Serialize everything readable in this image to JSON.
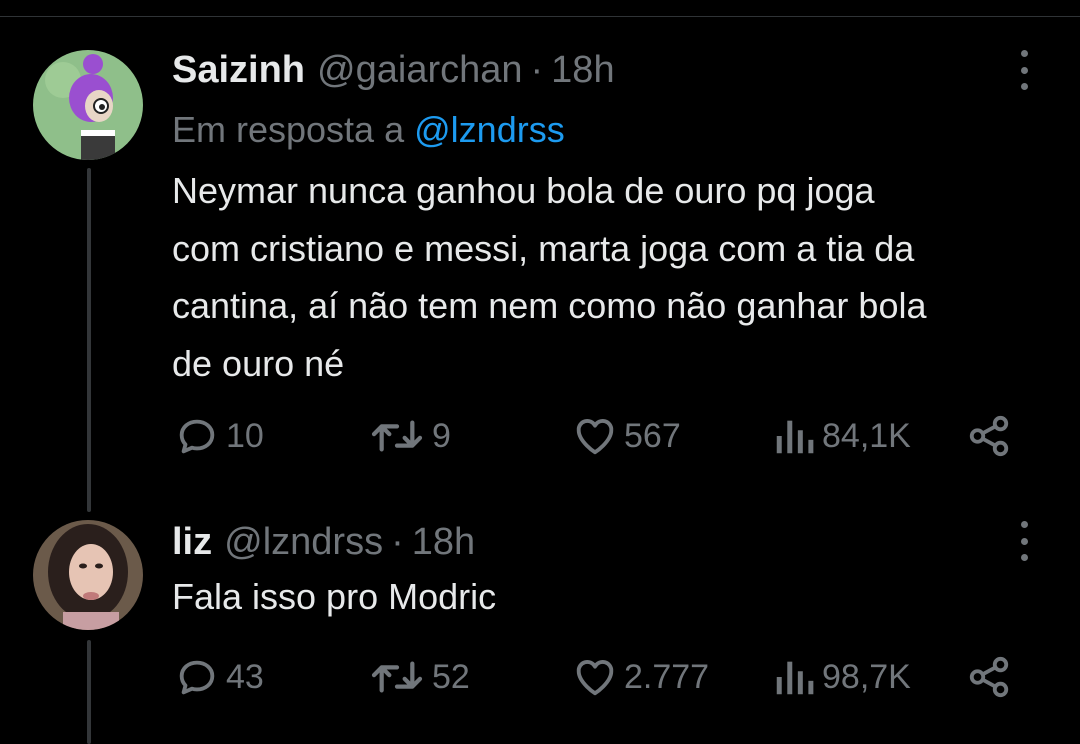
{
  "tweets": [
    {
      "display_name": "Saizinh",
      "handle": "@gaiarchan",
      "separator": "·",
      "time": "18h",
      "replying_prefix": "Em resposta a",
      "replying_to": "@lzndrss",
      "text_lines": [
        "Neymar nunca ganhou bola de ouro pq joga",
        "com cristiano e messi, marta joga com a tia da",
        "cantina, aí não tem nem como não ganhar bola",
        "de ouro né"
      ],
      "actions": {
        "replies": "10",
        "retweets": "9",
        "likes": "567",
        "views": "84,1K"
      }
    },
    {
      "display_name": "liz",
      "handle": "@lzndrss",
      "separator": "·",
      "time": "18h",
      "text_lines": [
        "Fala isso pro Modric"
      ],
      "actions": {
        "replies": "43",
        "retweets": "52",
        "likes": "2.777",
        "views": "98,7K"
      }
    }
  ],
  "icons": {
    "reply": "reply-icon",
    "retweet": "retweet-icon",
    "like": "heart-icon",
    "views": "views-icon",
    "share": "share-icon",
    "more": "more-icon"
  },
  "colors": {
    "background": "#000000",
    "primary_text": "#e7e9ea",
    "secondary_text": "#71767b",
    "link": "#1d9bf0"
  }
}
